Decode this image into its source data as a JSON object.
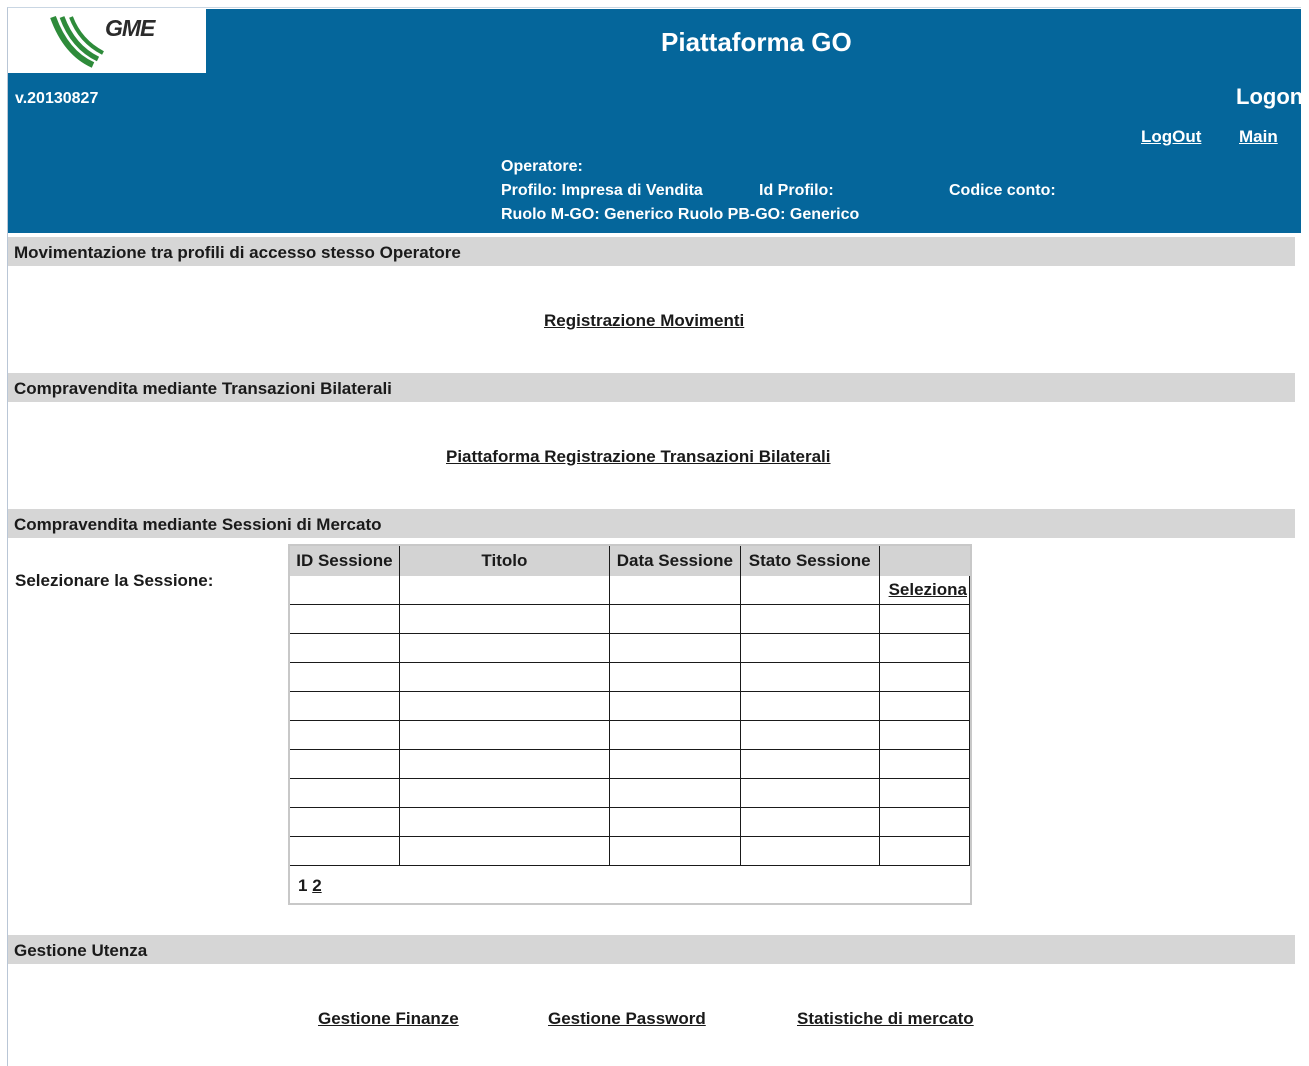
{
  "header": {
    "logo_text": "GME",
    "title": "Piattaforma GO",
    "version": "v.20130827",
    "logon": "Logon",
    "logout": "LogOut",
    "main": "Main",
    "operatore_label": "Operatore:",
    "profilo": "Profilo:  Impresa di Vendita",
    "id_profilo": "Id Profilo:",
    "codice_conto": "Codice conto:",
    "ruolo": "Ruolo M-GO:  Generico   Ruolo PB-GO:  Generico"
  },
  "sections": {
    "movimentazione": {
      "title": "Movimentazione tra profili di accesso stesso Operatore",
      "link": "Registrazione Movimenti"
    },
    "bilaterali": {
      "title": "Compravendita mediante Transazioni Bilaterali",
      "link": "Piattaforma Registrazione Transazioni Bilaterali"
    },
    "mercato": {
      "title": "Compravendita mediante Sessioni di Mercato",
      "select_label": "Selezionare la Sessione:",
      "columns": [
        "ID Sessione",
        "Titolo",
        "Data Sessione",
        "Stato Sessione",
        ""
      ],
      "row_action": "Seleziona",
      "pages": [
        "1",
        "2"
      ]
    },
    "utenza": {
      "title": "Gestione Utenza",
      "links": [
        "Gestione Finanze",
        "Gestione Password",
        "Statistiche di mercato"
      ]
    }
  },
  "colors": {
    "header_bg": "#05669b",
    "section_bar": "#d6d6d6",
    "logo_green": "#2e8b3a"
  }
}
